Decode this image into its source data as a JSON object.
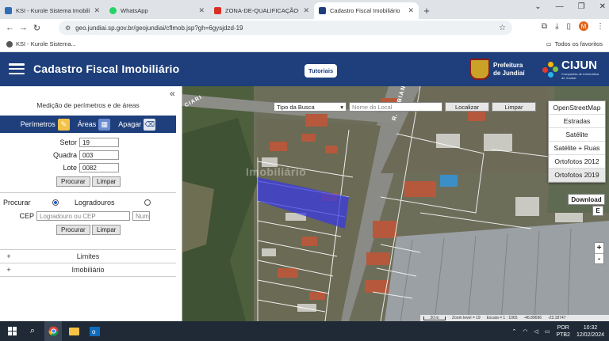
{
  "browser": {
    "tabs": [
      {
        "title": "KSI - Kurole Sistema Imobiliário",
        "color": "#2f6db5"
      },
      {
        "title": "WhatsApp",
        "color": "#25d366"
      },
      {
        "title": "ZONA-DE-QUALIFICAÇÃO-DO...",
        "color": "#d93025"
      },
      {
        "title": "Cadastro Fiscal Imobiliário",
        "color": "#1e3f7c"
      }
    ],
    "url": "geo.jundiai.sp.gov.br/geojundiai/cflmob.jsp?gh=6gysjdzd-19",
    "profile_initial": "M",
    "bookmark": "KSI - Kurole Sistema...",
    "all_bookmarks": "Todos os favoritos"
  },
  "header": {
    "title": "Cadastro Fiscal Imobiliário",
    "tutorials": "Tutoriais",
    "prefeitura_line1": "Prefeitura",
    "prefeitura_line2": "de Jundiaí",
    "cijun": "CIJUN",
    "cijun_sub1": "Companhia de Informática",
    "cijun_sub2": "de Jundiaí"
  },
  "panel": {
    "title": "Medição de perímetros e de áreas",
    "measure": {
      "perimetros": "Perímetros",
      "areas": "Áreas",
      "apagar": "Apagar"
    },
    "fields": {
      "setor_label": "Setor",
      "setor_value": "19",
      "quadra_label": "Quadra",
      "quadra_value": "003",
      "lote_label": "Lote",
      "lote_value": "0082"
    },
    "buttons": {
      "procurar": "Procurar",
      "limpar": "Limpar"
    },
    "search": {
      "procurar_label": "Procurar",
      "logradouros_label": "Logradouros",
      "cep_label": "CEP",
      "cep_placeholder": "Logradouro ou CEP",
      "num_placeholder": "Num"
    },
    "accordions": {
      "limites": "Limites",
      "imobiliario": "Imobiliário"
    }
  },
  "map": {
    "tipo_busca": "Tipo da Busca",
    "nome_local_placeholder": "Nome do Local",
    "localizar": "Localizar",
    "limpar": "Limpar",
    "layers": [
      "OpenStreetMap",
      "Estradas",
      "Satélite",
      "Satélite + Ruas",
      "Ortofotos 2012",
      "Ortofotos 2019"
    ],
    "selected_layer": "Ortofotos 2019",
    "download": "Download",
    "e_button": "E",
    "zoom_in": "+",
    "zoom_out": "-",
    "street_label": "R. P. BIANCA PA",
    "street_label2": "CIARI",
    "watermark": "Imobiliário",
    "scale_label": "20 m",
    "zoom_level": "Zoom level = 19",
    "scale_text": "Escala = 1 : 1065",
    "coord_x": "-46.89696",
    "coord_y": "-23.18747",
    "highlight_color": "#3a3ae0"
  },
  "taskbar": {
    "lang1": "POR",
    "lang2": "PTB2",
    "time": "10:32",
    "date": "12/02/2024"
  }
}
